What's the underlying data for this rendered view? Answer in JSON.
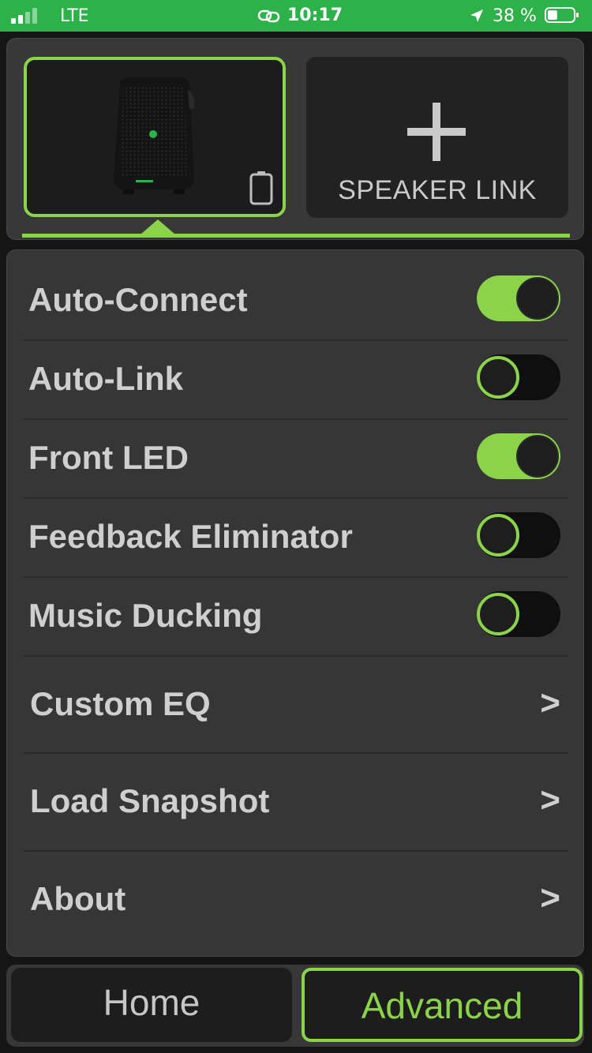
{
  "status_bar": {
    "carrier": "LTE",
    "time": "10:17",
    "battery_percent": "38 %",
    "battery_level": 0.38,
    "signal_bars": 2,
    "icons": [
      "signal-icon",
      "link-icon",
      "location-arrow-icon",
      "battery-icon"
    ]
  },
  "speaker_panel": {
    "link_label": "SPEAKER LINK",
    "icons": [
      "speaker-image",
      "speaker-battery-icon",
      "plus-icon"
    ],
    "accent": "#8bd44a"
  },
  "settings": {
    "toggles": [
      {
        "label": "Auto-Connect",
        "on": true
      },
      {
        "label": "Auto-Link",
        "on": false
      },
      {
        "label": "Front LED",
        "on": true
      },
      {
        "label": "Feedback Eliminator",
        "on": false
      },
      {
        "label": "Music Ducking",
        "on": false
      }
    ],
    "links": [
      {
        "label": "Custom EQ",
        "chevron": ">"
      },
      {
        "label": "Load Snapshot",
        "chevron": ">"
      },
      {
        "label": "About",
        "chevron": ">"
      }
    ]
  },
  "tabs": {
    "home": "Home",
    "advanced": "Advanced",
    "selected": "advanced"
  },
  "colors": {
    "status_bar": "#2db24a",
    "accent_green": "#8bd44a",
    "panel_bg": "#363636",
    "text": "#cfcfcf"
  }
}
